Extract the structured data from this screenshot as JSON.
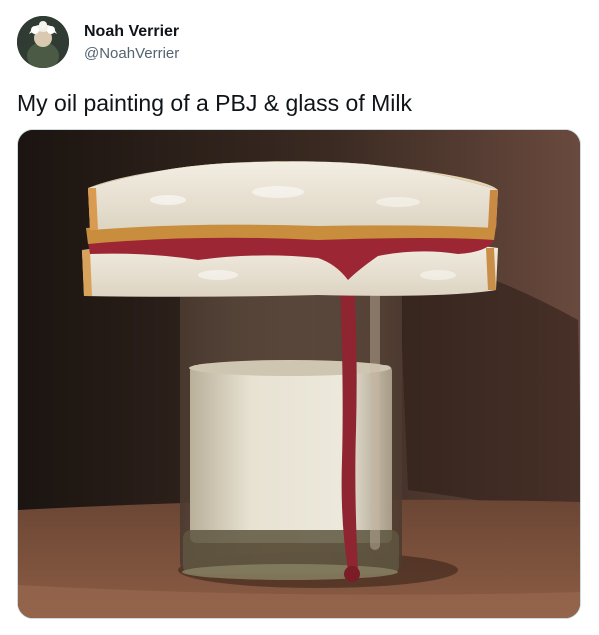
{
  "tweet": {
    "author": {
      "name": "Noah Verrier",
      "handle": "@NoahVerrier",
      "avatar_icon": "portrait-avatar"
    },
    "text": "My oil painting of a PBJ & glass of Milk",
    "media": {
      "type": "oil-painting"
    }
  },
  "colors": {
    "name_text": "#0f1419",
    "handle_text": "#536471",
    "media_border": "#cfd9de"
  }
}
